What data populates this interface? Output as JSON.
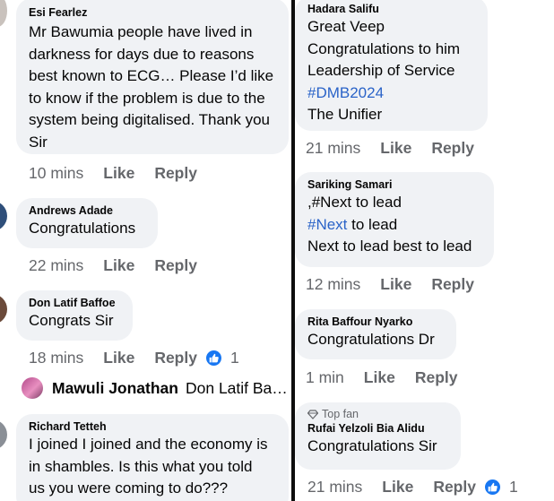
{
  "left": {
    "comments": [
      {
        "author": "Esi Fearlez",
        "text": "Mr Bawumia people have lived in\ndarkness for days due to reasons\nbest known to ECG… Please I’d like\nto know if the problem is due to the\nsystem being digitalised. Thank you\nSir",
        "time": "10 mins",
        "like": "Like",
        "reply": "Reply"
      },
      {
        "author": "Andrews Adade",
        "text": "Congratulations",
        "time": "22 mins",
        "like": "Like",
        "reply": "Reply"
      },
      {
        "author": "Don Latif Baffoe",
        "text": "Congrats Sir",
        "time": "18 mins",
        "like": "Like",
        "reply": "Reply",
        "reaction_count": "1",
        "reply_preview": {
          "author": "Mawuli Jonathan",
          "snippet": "Don Latif Ba…"
        }
      },
      {
        "author": "Richard Tetteh",
        "text": "I joined I joined and the economy is\nin shambles. Is this what you told\nus you were coming to do???"
      }
    ]
  },
  "right": {
    "comments": [
      {
        "author": "Hadara Salifu",
        "lines": [
          "Great Veep",
          "Congratulations to him",
          "Leadership of Service"
        ],
        "hashtag": "#DMB2024",
        "last_line": "The Unifier",
        "time": "21 mins",
        "like": "Like",
        "reply": "Reply"
      },
      {
        "author": "Sariking Samari",
        "line1": ",#Next to lead",
        "hashtag": "#Next",
        "line2_rest": " to lead",
        "line3": "Next to lead best to lead",
        "time": "12 mins",
        "like": "Like",
        "reply": "Reply"
      },
      {
        "author": "Rita Baffour Nyarko",
        "text": "Congratulations Dr",
        "time": "1 min",
        "like": "Like",
        "reply": "Reply"
      },
      {
        "badge": "Top fan",
        "author": "Rufai Yelzoli Bia Alidu",
        "text": "Congratulations Sir",
        "time": "21 mins",
        "like": "Like",
        "reply": "Reply",
        "reaction_count": "1"
      }
    ]
  },
  "colors": {
    "bubble": "#f0f2f5",
    "meta": "#65676b",
    "hashtag": "#2a63c8",
    "like_blue": "#1877f2"
  }
}
